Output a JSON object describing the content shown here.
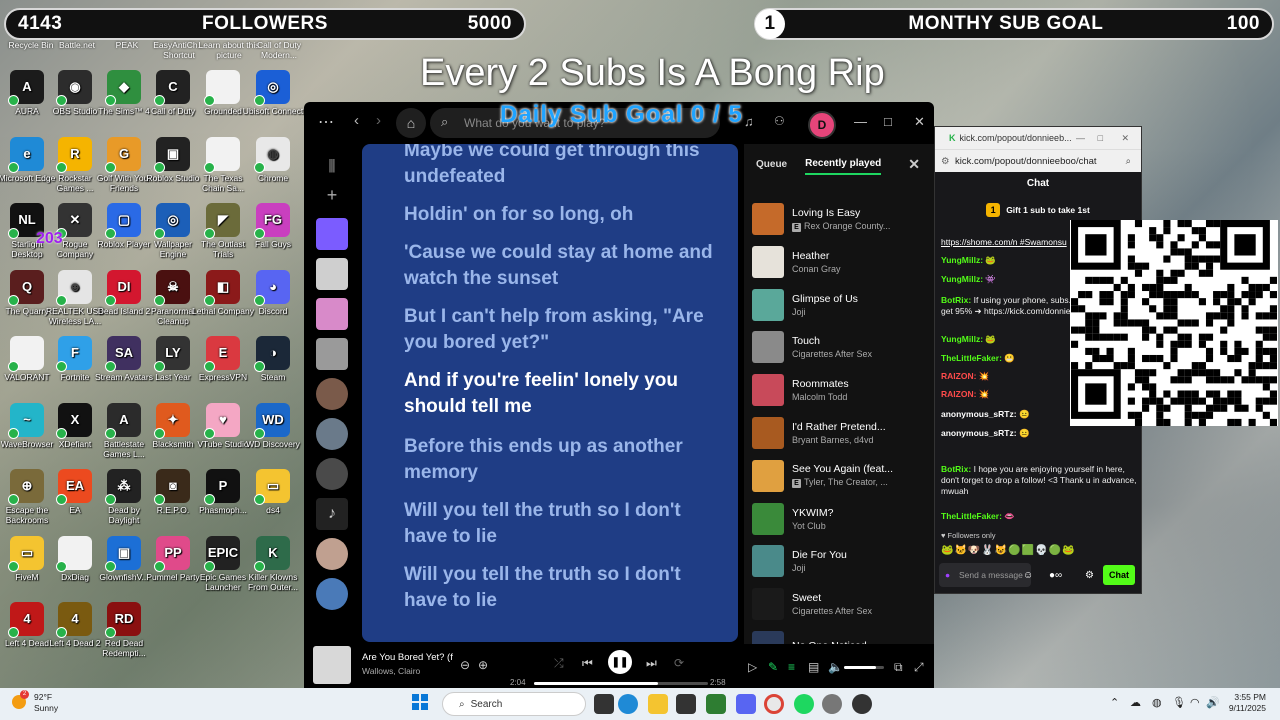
{
  "overlay": {
    "followers_current": "4143",
    "followers_label": "FOLLOWERS",
    "followers_goal": "5000",
    "sub_current": "1",
    "sub_label": "MONTHY SUB GOAL",
    "sub_goal": "100",
    "banner": "Every 2 Subs Is A Bong Rip",
    "daily_goal": "Daily Sub Goal  0 / 5"
  },
  "desktop": {
    "top_labels": [
      "Recycle Bin",
      "Battle.net",
      "PEAK",
      "EasyAntiCh... Shortcut",
      "Learn about this picture",
      "Call of Duty Modern..."
    ],
    "icons": [
      {
        "label": "AURA",
        "color": "#1b1b1b",
        "glyph": "A"
      },
      {
        "label": "OBS Studio",
        "color": "#2c2c2c",
        "glyph": "◉"
      },
      {
        "label": "The Sims™ 4",
        "color": "#2f8f3f",
        "glyph": "◆"
      },
      {
        "label": "Call of Duty",
        "color": "#222",
        "glyph": "C"
      },
      {
        "label": "Grounded",
        "color": "#f2f2f2",
        "glyph": ""
      },
      {
        "label": "Ubisoft Connect",
        "color": "#1b5fd6",
        "glyph": "◎"
      },
      {
        "label": "Microsoft Edge",
        "color": "#1f8ad6",
        "glyph": "e"
      },
      {
        "label": "Rockstar Games ...",
        "color": "#f5b400",
        "glyph": "R"
      },
      {
        "label": "Golf With Your Friends",
        "color": "#e89a28",
        "glyph": "G"
      },
      {
        "label": "Roblox Studio",
        "color": "#222",
        "glyph": "▣"
      },
      {
        "label": "The Texas Chain Sa...",
        "color": "#f2f2f2",
        "glyph": ""
      },
      {
        "label": "Chrome",
        "color": "#e8e8e8",
        "glyph": "◍"
      },
      {
        "label": "Starlight Desktop",
        "color": "#111",
        "glyph": "NL"
      },
      {
        "label": "Rogue Company",
        "color": "#333",
        "glyph": "✕"
      },
      {
        "label": "Roblox Player",
        "color": "#2a6ae6",
        "glyph": "▢"
      },
      {
        "label": "Wallpaper Engine",
        "color": "#1c5fb8",
        "glyph": "◎"
      },
      {
        "label": "The Outlast Trials",
        "color": "#6b6b3a",
        "glyph": "◤"
      },
      {
        "label": "Fall Guys",
        "color": "#c93fbf",
        "glyph": "FG"
      },
      {
        "label": "The Quarry",
        "color": "#5a1e1e",
        "glyph": "Q"
      },
      {
        "label": "REALTEK USB Wireless LA...",
        "color": "#e5e5e5",
        "glyph": "☻"
      },
      {
        "label": "Dead Island 2",
        "color": "#d3172f",
        "glyph": "DI"
      },
      {
        "label": "Paranormal Cleanup",
        "color": "#4a1010",
        "glyph": "☠"
      },
      {
        "label": "Lethal Company",
        "color": "#8b1a1a",
        "glyph": "◧"
      },
      {
        "label": "Discord",
        "color": "#5865f2",
        "glyph": "◕"
      },
      {
        "label": "VALORANT",
        "color": "#f2f2f2",
        "glyph": ""
      },
      {
        "label": "Fortnite",
        "color": "#2fa0e8",
        "glyph": "F"
      },
      {
        "label": "Stream Avatars",
        "color": "#403060",
        "glyph": "SA"
      },
      {
        "label": "Last Year",
        "color": "#333",
        "glyph": "LY"
      },
      {
        "label": "ExpressVPN",
        "color": "#da3940",
        "glyph": "E"
      },
      {
        "label": "Steam",
        "color": "#1b2838",
        "glyph": "◑"
      },
      {
        "label": "WaveBrowser",
        "color": "#23b5c9",
        "glyph": "~"
      },
      {
        "label": "XDefiant",
        "color": "#111",
        "glyph": "X"
      },
      {
        "label": "Battlestate Games L...",
        "color": "#2b2b2b",
        "glyph": "A"
      },
      {
        "label": "Blacksmith",
        "color": "#e05a1e",
        "glyph": "✦"
      },
      {
        "label": "VTube Studio",
        "color": "#f4a7c4",
        "glyph": "♥"
      },
      {
        "label": "WD Discovery",
        "color": "#1b68c9",
        "glyph": "WD"
      },
      {
        "label": "Escape the Backrooms",
        "color": "#7a6a3a",
        "glyph": "⊕"
      },
      {
        "label": "EA",
        "color": "#ec4a1f",
        "glyph": "EA"
      },
      {
        "label": "Dead by Daylight",
        "color": "#222",
        "glyph": "⁂"
      },
      {
        "label": "R.E.P.O.",
        "color": "#3a2a1a",
        "glyph": "◙"
      },
      {
        "label": "Phasmoph...",
        "color": "#111",
        "glyph": "P"
      },
      {
        "label": "ds4",
        "color": "#f4c430",
        "glyph": "▭"
      },
      {
        "label": "FiveM",
        "color": "#f4c430",
        "glyph": "▭"
      },
      {
        "label": "DxDiag",
        "color": "#f2f2f2",
        "glyph": ""
      },
      {
        "label": "GlownfishV...",
        "color": "#1c6fd6",
        "glyph": "▣"
      },
      {
        "label": "Pummel Party",
        "color": "#e04a8a",
        "glyph": "PP"
      },
      {
        "label": "Epic Games Launcher",
        "color": "#222",
        "glyph": "EPIC"
      },
      {
        "label": "Killer Klowns From Outer...",
        "color": "#2e6b4a",
        "glyph": "K"
      },
      {
        "label": "Left 4 Dead",
        "color": "#c01818",
        "glyph": "4"
      },
      {
        "label": "Left 4 Dead 2",
        "color": "#7a5a10",
        "glyph": "4"
      },
      {
        "label": "Red Dead Redempti...",
        "color": "#8a1010",
        "glyph": "RD"
      }
    ],
    "chrome_overlay": "203"
  },
  "spotify": {
    "search_placeholder": "What do you want to play?",
    "avatar": "D",
    "lyrics": [
      {
        "text": "Maybe we could get through this undefeated",
        "active": false
      },
      {
        "text": "Holdin' on for so long, oh",
        "active": false
      },
      {
        "text": "'Cause we could stay at home and watch the sunset",
        "active": false
      },
      {
        "text": "But I can't help from asking, \"Are you bored yet?\"",
        "active": false
      },
      {
        "text": "And if you're feelin' lonely you should tell me",
        "active": true
      },
      {
        "text": "Before this ends up as another memory",
        "active": false
      },
      {
        "text": "Will you tell the truth so I don't have to lie",
        "active": false
      },
      {
        "text": "Will you tell the truth so I don't have to lie",
        "active": false
      }
    ],
    "queue_tab": "Queue",
    "recent_tab": "Recently played",
    "recent": [
      {
        "title": "Loving Is Easy",
        "artist": "Rex Orange County...",
        "explicit": true,
        "color": "#c56a2a"
      },
      {
        "title": "Heather",
        "artist": "Conan Gray",
        "explicit": false,
        "color": "#e6e2da"
      },
      {
        "title": "Glimpse of Us",
        "artist": "Joji",
        "explicit": false,
        "color": "#5aa89a"
      },
      {
        "title": "Touch",
        "artist": "Cigarettes After Sex",
        "explicit": false,
        "color": "#8a8a8a"
      },
      {
        "title": "Roommates",
        "artist": "Malcolm Todd",
        "explicit": false,
        "color": "#c84a5a"
      },
      {
        "title": "I'd Rather Pretend...",
        "artist": "Bryant Barnes, d4vd",
        "explicit": false,
        "color": "#a85a20"
      },
      {
        "title": "See You Again (feat...",
        "artist": "Tyler, The Creator, ...",
        "explicit": true,
        "color": "#e0a040"
      },
      {
        "title": "YKWIM?",
        "artist": "Yot Club",
        "explicit": false,
        "color": "#3a8a3a"
      },
      {
        "title": "Die For You",
        "artist": "Joji",
        "explicit": false,
        "color": "#4a8a8a"
      },
      {
        "title": "Sweet",
        "artist": "Cigarettes After Sex",
        "explicit": false,
        "color": "#1a1a1a"
      },
      {
        "title": "No One Noticed",
        "artist": "",
        "explicit": false,
        "color": "#2a3a5a"
      }
    ],
    "now_playing": {
      "title": "Are You Bored Yet? (f",
      "artist": "Wallows, Clairo",
      "elapsed": "2:04",
      "duration": "2:58",
      "progress": 0.71,
      "volume": 0.8
    },
    "library_colors": [
      "#7b5cff",
      "#cfcfcf",
      "#d88ac9",
      "#9a9a9a",
      "#7a5a4a",
      "#6a7a8a",
      "#4a4a4a",
      "#2a2a2a",
      "#c0a090",
      "#4a7ab8"
    ]
  },
  "kick": {
    "tab_title": "kick.com/popout/donnieeb...",
    "url": "kick.com/popout/donnieeboo/chat",
    "header": "Chat",
    "gift_count": "1",
    "gift_text": "Gift 1 sub to take 1st",
    "messages": [
      {
        "user": "",
        "text": "https://shome.com/n #Swamonsu",
        "cls": "u-link"
      },
      {
        "user": "YungMillz:",
        "text": "🐸",
        "cls": "u-green"
      },
      {
        "user": "YungMillz:",
        "text": "👾",
        "cls": "u-green"
      },
      {
        "user": "BotRix:",
        "text": "If using your phone, subs. Cost less and I get 95% ➜ https://kick.com/donnieeboo",
        "cls": "u-green"
      },
      {
        "user": "YungMillz:",
        "text": "🐸",
        "cls": "u-green"
      },
      {
        "user": "TheLittleFaker:",
        "text": "😬",
        "cls": "u-green"
      },
      {
        "user": "RAIZON:",
        "text": "💥",
        "cls": "u-red"
      },
      {
        "user": "RAIZON:",
        "text": "💥",
        "cls": "u-red"
      },
      {
        "user": "anonymous_sRTz:",
        "text": "😐",
        "cls": "u-white"
      },
      {
        "user": "anonymous_sRTz:",
        "text": "😐",
        "cls": "u-white"
      },
      {
        "user": "BotRix:",
        "text": "I hope you are enjoying yourself in here, don't forget to drop a follow! <3 Thank u in advance, mwuah",
        "cls": "u-green"
      },
      {
        "user": "TheLittleFaker:",
        "text": "👄",
        "cls": "u-green"
      }
    ],
    "followers_only": "Followers only",
    "input_placeholder": "Send a message",
    "chat_button": "Chat"
  },
  "taskbar": {
    "temp": "92°F",
    "weather": "Sunny",
    "search": "Search",
    "time": "3:55 PM",
    "date": "9/11/2025",
    "weather_badge": "2"
  }
}
